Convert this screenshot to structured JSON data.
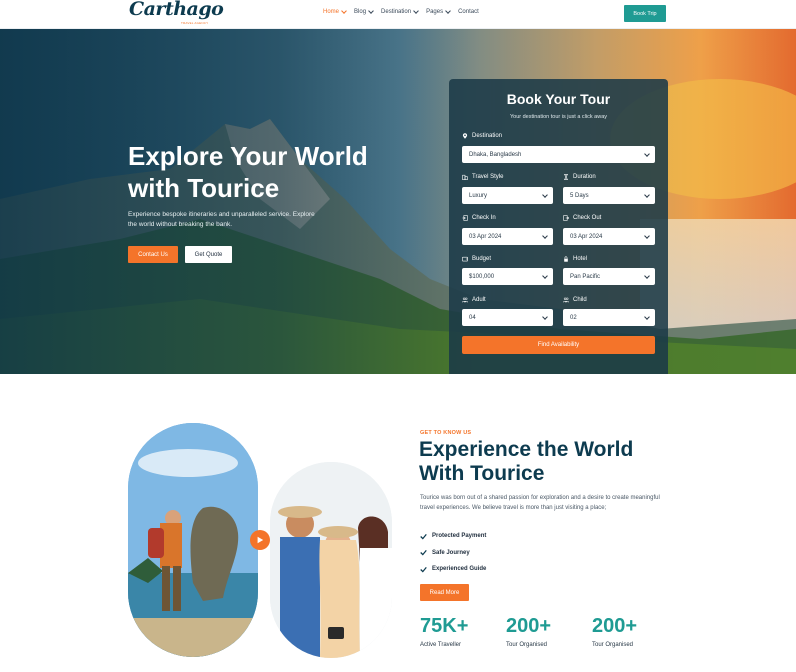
{
  "header": {
    "logo_text": "Carthago",
    "logo_sub": "TRAVEL AGENCY",
    "nav": [
      {
        "label": "Home",
        "active": true,
        "dropdown": true
      },
      {
        "label": "Blog",
        "active": false,
        "dropdown": true
      },
      {
        "label": "Destination",
        "active": false,
        "dropdown": true
      },
      {
        "label": "Pages",
        "active": false,
        "dropdown": true
      },
      {
        "label": "Contact",
        "active": false,
        "dropdown": false
      }
    ],
    "cta": "Book Trip"
  },
  "hero": {
    "title": "Explore Your World with Tourice",
    "description": "Experience bespoke itineraries and unparalleled service. Explore the world without breaking the bank.",
    "primary_button": "Contact Us",
    "secondary_button": "Get Quote"
  },
  "booking": {
    "title": "Book Your Tour",
    "subtitle": "Your destination tour is just a click away",
    "destination": {
      "label": "Destination",
      "value": "Dhaka, Bangladesh"
    },
    "travel_style": {
      "label": "Travel Style",
      "value": "Luxury"
    },
    "duration": {
      "label": "Duration",
      "value": "5 Days"
    },
    "check_in": {
      "label": "Check In",
      "value": "03 Apr 2024"
    },
    "check_out": {
      "label": "Check Out",
      "value": "03 Apr 2024"
    },
    "budget": {
      "label": "Budget",
      "value": "$100,000"
    },
    "hotel": {
      "label": "Hotel",
      "value": "Pan Pacific"
    },
    "adult": {
      "label": "Adult",
      "value": "04"
    },
    "child": {
      "label": "Child",
      "value": "02"
    },
    "submit": "Find Availability"
  },
  "about": {
    "kicker": "GET TO KNOW US",
    "title": "Experience the World With Tourice",
    "description": "Tourice was born out of a shared passion for exploration and a desire to create meaningful travel experiences. We believe travel is more than just visiting a place;",
    "features": [
      "Protected Payment",
      "Safe Journey",
      "Experienced Guide"
    ],
    "button": "Read More",
    "stats": [
      {
        "value": "75K+",
        "label": "Active Traveller"
      },
      {
        "value": "200+",
        "label": "Tour Organised"
      },
      {
        "value": "200+",
        "label": "Tour Organised"
      }
    ]
  },
  "colors": {
    "accent": "#f4742a",
    "teal": "#1f9b93",
    "navy": "#0d3b4f"
  }
}
